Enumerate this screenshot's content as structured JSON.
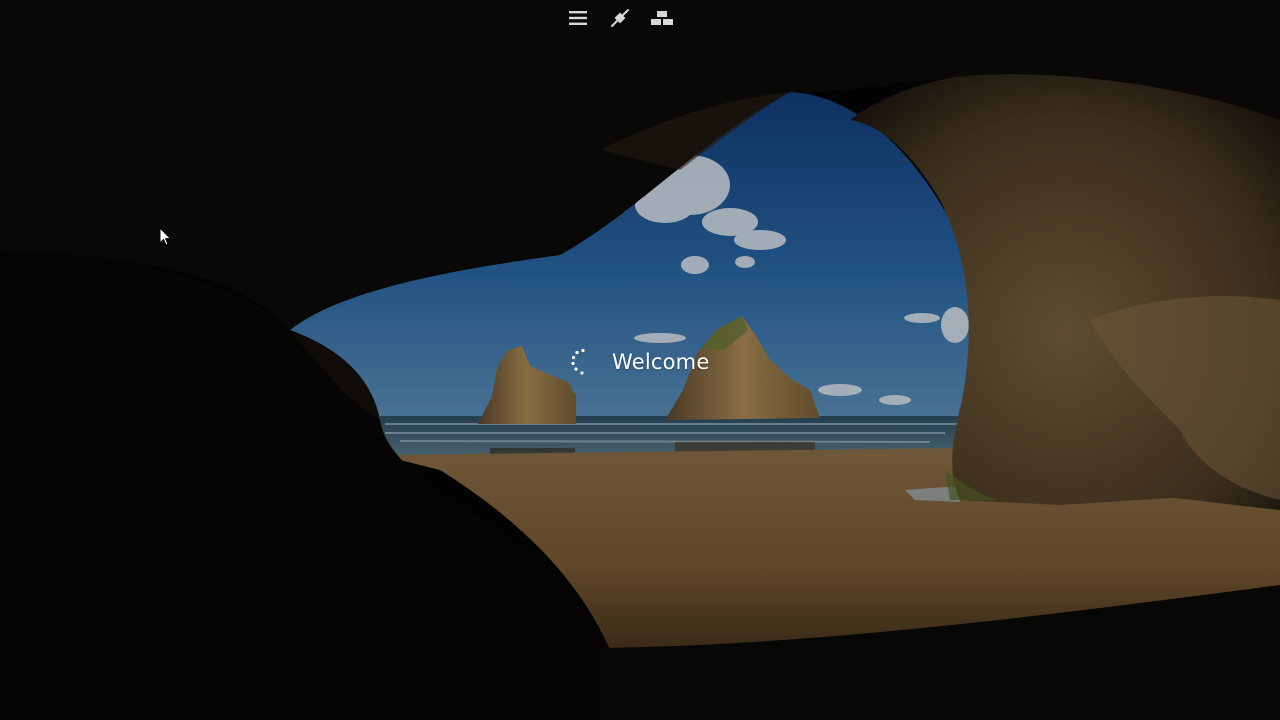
{
  "toolbar": {
    "items": [
      {
        "name": "menu",
        "icon": "hamburger-menu-icon"
      },
      {
        "name": "connection",
        "icon": "plug-icon"
      },
      {
        "name": "windows",
        "icon": "window-switch-icon"
      }
    ],
    "icon_color": "#d8d8d8"
  },
  "welcome": {
    "text": "Welcome",
    "spinner_icon": "loading-spinner-icon"
  },
  "background": {
    "scene": "lock-screen-wallpaper",
    "sky_color": "#1f5fa3",
    "sand_color": "#8a6a3e",
    "rock_color": "#6b5332"
  },
  "pointer": {
    "icon": "mouse-cursor-icon"
  }
}
